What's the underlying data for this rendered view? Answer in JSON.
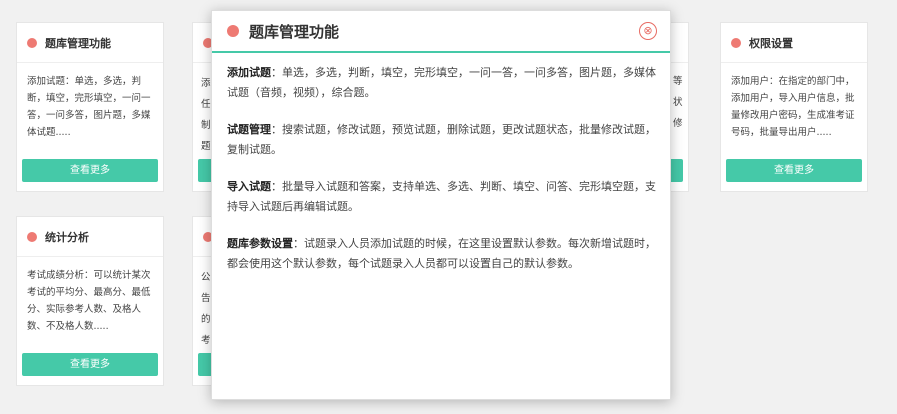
{
  "cards": [
    {
      "title": "题库管理功能",
      "desc": "添加试题：单选，多选，判断，填空，完形填空，一问一答，一问多答，图片题，多媒体试题.....",
      "button": "查看更多"
    },
    {
      "title": "",
      "desc": "添任制题",
      "button": ""
    },
    {
      "title": "",
      "desc": "等状修",
      "button": ""
    },
    {
      "title": "权限设置",
      "desc": "添加用户：在指定的部门中，添加用户，导入用户信息，批量修改用户密码，生成准考证号码，批量导出用户.....",
      "button": "查看更多"
    },
    {
      "title": "统计分析",
      "desc": "考试成绩分析：可以统计某次考试的平均分、最高分、最低分、实际参考人数、及格人数、不及格人数.....",
      "button": "查看更多"
    },
    {
      "title": "",
      "desc": "公告的考",
      "button": ""
    }
  ],
  "modal": {
    "title": "题库管理功能",
    "close_icon": "⊗",
    "sections": [
      {
        "label": "添加试题",
        "text": "：单选，多选，判断，填空，完形填空，一问一答，一问多答，图片题，多媒体试题（音频，视频），综合题。"
      },
      {
        "label": "试题管理",
        "text": "：搜索试题，修改试题，预览试题，删除试题，更改试题状态，批量修改试题，复制试题。"
      },
      {
        "label": "导入试题",
        "text": "：批量导入试题和答案，支持单选、多选、判断、填空、问答、完形填空题，支持导入试题后再编辑试题。"
      },
      {
        "label": "题库参数设置",
        "text": "：试题录入人员添加试题的时候，在这里设置默认参数。每次新增试题时，都会使用这个默认参数，每个试题录入人员都可以设置自己的默认参数。"
      }
    ]
  },
  "colors": {
    "accent": "#45c9a8",
    "dot": "#ee7a73",
    "close": "#e76b63"
  }
}
